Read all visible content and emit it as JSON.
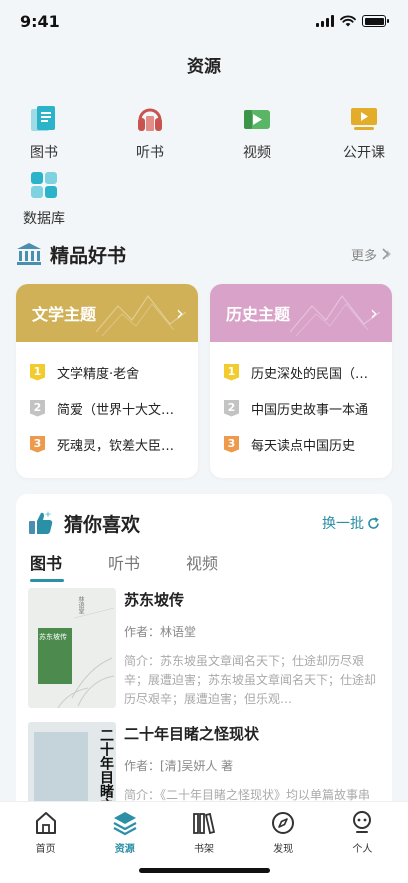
{
  "status": {
    "time": "9:41"
  },
  "page": {
    "title": "资源"
  },
  "categories": [
    {
      "label": "图书",
      "icon": "book-icon"
    },
    {
      "label": "听书",
      "icon": "headphones-icon"
    },
    {
      "label": "视频",
      "icon": "video-icon"
    },
    {
      "label": "公开课",
      "icon": "presentation-icon"
    },
    {
      "label": "数据库",
      "icon": "database-icon"
    }
  ],
  "featured": {
    "title": "精品好书",
    "more_label": "更多",
    "themes": [
      {
        "name": "文学主题",
        "color": "#d1b157",
        "items": [
          {
            "rank": "1",
            "text": "文学精度·老舍"
          },
          {
            "rank": "2",
            "text": "简爱（世界十大文学…"
          },
          {
            "rank": "3",
            "text": "死魂灵，钦差大臣（…"
          }
        ]
      },
      {
        "name": "历史主题",
        "color": "#d9a2c9",
        "items": [
          {
            "rank": "1",
            "text": "历史深处的民国（全…"
          },
          {
            "rank": "2",
            "text": "中国历史故事一本通"
          },
          {
            "rank": "3",
            "text": "每天读点中国历史"
          }
        ]
      }
    ],
    "rank_colors": [
      "#f2cb2e",
      "#c3c3c3",
      "#ee9a4c"
    ]
  },
  "guess": {
    "title": "猜你喜欢",
    "refresh_label": "换一批",
    "tabs": [
      "图书",
      "听书",
      "视频"
    ],
    "active_tab": 0,
    "books": [
      {
        "title": "苏东坡传",
        "author": "作者：林语堂",
        "intro": "简介：苏东坡虽文章闻名天下；仕途却历尽艰辛；展遭迫害；苏东坡虽文章闻名天下；仕途却历尽艰辛；展遭迫害；但乐观…",
        "cover_title": "苏东坡传",
        "cover_author": "林语堂"
      },
      {
        "title": "二十年目睹之怪现状",
        "author": "作者：[清]吴妍人 著",
        "intro": "简介：《二十年目睹之怪现状》均以单篇故事串",
        "cover_title": "二十年目睹之怪现"
      }
    ]
  },
  "tabbar": {
    "items": [
      {
        "label": "首页",
        "icon": "home-icon"
      },
      {
        "label": "资源",
        "icon": "layers-icon"
      },
      {
        "label": "书架",
        "icon": "bookshelf-icon"
      },
      {
        "label": "发现",
        "icon": "compass-icon"
      },
      {
        "label": "个人",
        "icon": "profile-icon"
      }
    ],
    "active": 1,
    "accent": "#2b8fa6"
  }
}
